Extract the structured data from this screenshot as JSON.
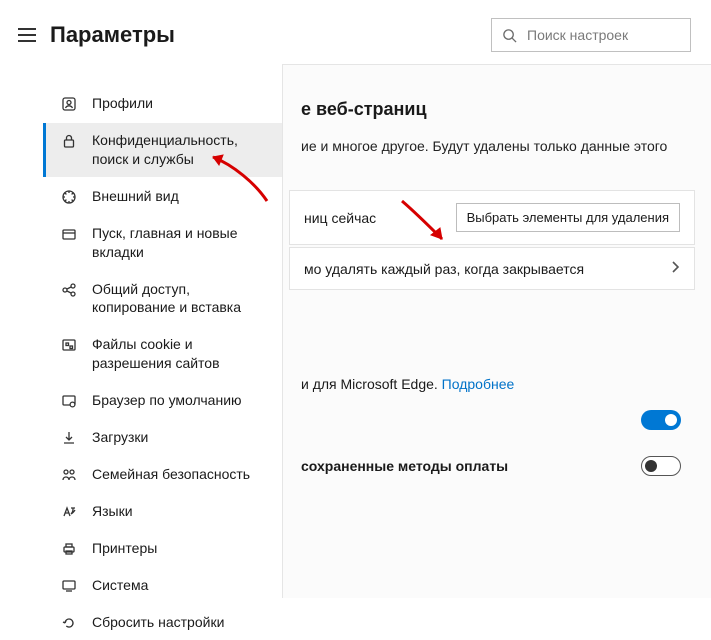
{
  "header": {
    "title": "Параметры",
    "search_placeholder": "Поиск настроек"
  },
  "sidebar": {
    "items": [
      {
        "label": "Профили",
        "icon": "profile-icon"
      },
      {
        "label": "Конфиденциальность, поиск и службы",
        "icon": "lock-icon",
        "active": true
      },
      {
        "label": "Внешний вид",
        "icon": "appearance-icon"
      },
      {
        "label": "Пуск, главная и новые вкладки",
        "icon": "tab-icon"
      },
      {
        "label": "Общий доступ, копирование и вставка",
        "icon": "share-icon"
      },
      {
        "label": "Файлы cookie и разрешения сайтов",
        "icon": "cookie-icon"
      },
      {
        "label": "Браузер по умолчанию",
        "icon": "default-browser-icon"
      },
      {
        "label": "Загрузки",
        "icon": "download-icon"
      },
      {
        "label": "Семейная безопасность",
        "icon": "family-icon"
      },
      {
        "label": "Языки",
        "icon": "languages-icon"
      },
      {
        "label": "Принтеры",
        "icon": "printer-icon"
      },
      {
        "label": "Система",
        "icon": "system-icon"
      },
      {
        "label": "Сбросить настройки",
        "icon": "reset-icon"
      }
    ]
  },
  "content": {
    "section_heading": "е веб-страниц",
    "section_desc": "ие и многое другое. Будут удалены только данные этого",
    "row1_label": "ниц сейчас",
    "row1_button": "Выбрать элементы для удаления",
    "row2_label": "мо удалять каждый раз, когда закрывается",
    "services_text": "и для Microsoft Edge. ",
    "services_link": "Подробнее",
    "toggle1_label": "",
    "toggle2_label": "сохраненные методы оплаты"
  }
}
